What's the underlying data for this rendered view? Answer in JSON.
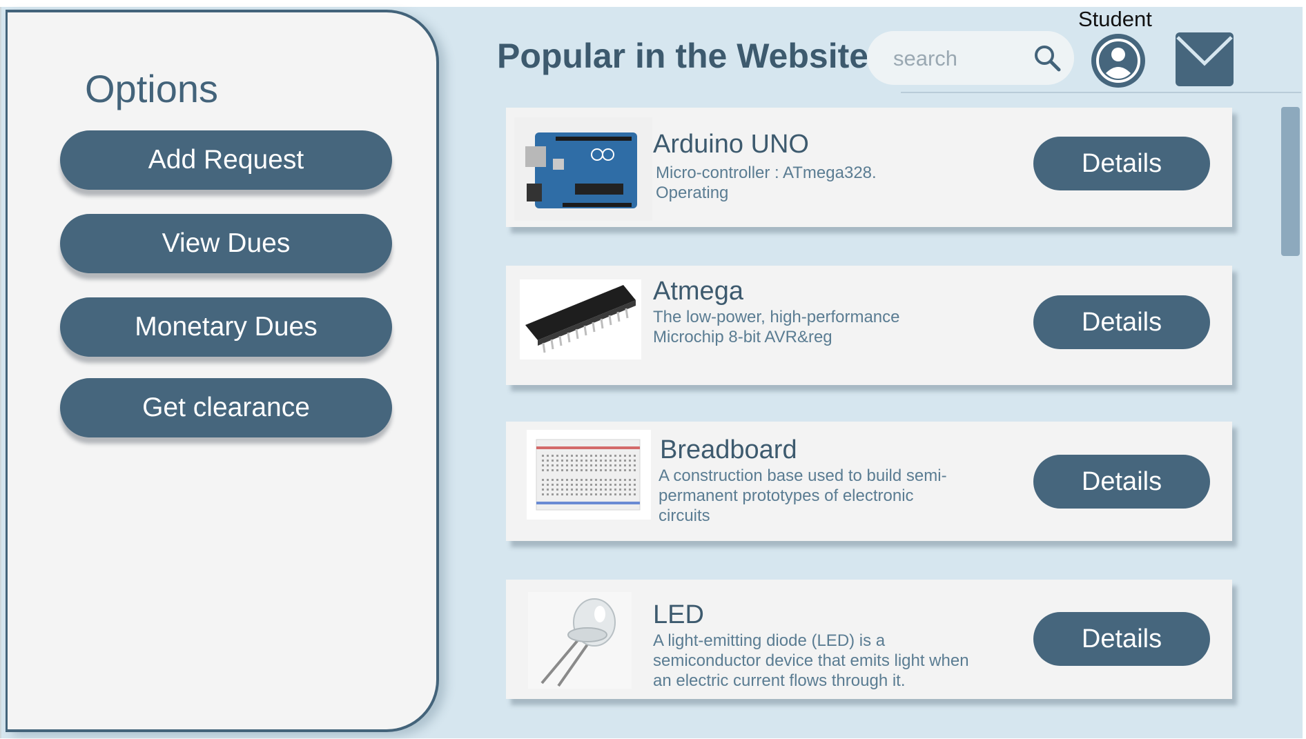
{
  "sidebar": {
    "title": "Options",
    "buttons": [
      {
        "label": "Add Request"
      },
      {
        "label": "View Dues"
      },
      {
        "label": "Monetary Dues"
      },
      {
        "label": "Get clearance"
      }
    ]
  },
  "header": {
    "title": "Popular in the Website",
    "search": {
      "placeholder": "search",
      "value": ""
    },
    "user": {
      "label": "Student"
    }
  },
  "items": [
    {
      "name": "Arduino UNO",
      "description": "Micro-controller : ATmega328. Operating",
      "details_label": "Details",
      "thumbnail": "arduino-board"
    },
    {
      "name": "Atmega",
      "description": "The low-power, high-performance Microchip 8-bit AVR&reg",
      "details_label": "Details",
      "thumbnail": "atmega-chip"
    },
    {
      "name": "Breadboard",
      "description": "A construction base used to build semi-permanent prototypes of electronic circuits",
      "details_label": "Details",
      "thumbnail": "breadboard"
    },
    {
      "name": "LED",
      "description": "A light-emitting diode (LED) is a semiconductor device that emits light when an electric current flows through it.",
      "details_label": "Details",
      "thumbnail": "led"
    }
  ],
  "colors": {
    "primary": "#46667d",
    "background": "#d6e6ef",
    "panel": "#f4f4f4",
    "text_heading": "#3d5a6e",
    "text_muted": "#5a7c92"
  }
}
